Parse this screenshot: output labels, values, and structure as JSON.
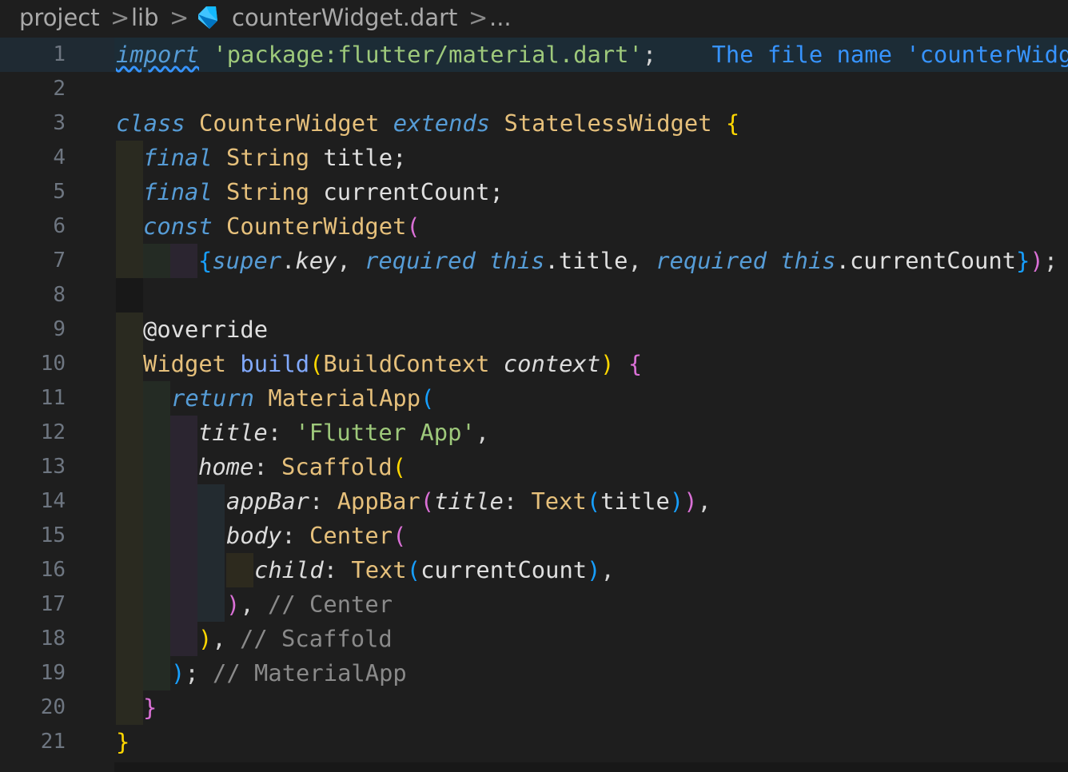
{
  "breadcrumb": {
    "items": [
      "project",
      "lib",
      "counterWidget.dart",
      "..."
    ],
    "separator": ">",
    "file_icon": "dart-icon"
  },
  "editor": {
    "lines": [
      {
        "n": "1"
      },
      {
        "n": "2"
      },
      {
        "n": "3"
      },
      {
        "n": "4"
      },
      {
        "n": "5"
      },
      {
        "n": "6"
      },
      {
        "n": "7"
      },
      {
        "n": "8"
      },
      {
        "n": "9"
      },
      {
        "n": "10"
      },
      {
        "n": "11"
      },
      {
        "n": "12"
      },
      {
        "n": "13"
      },
      {
        "n": "14"
      },
      {
        "n": "15"
      },
      {
        "n": "16"
      },
      {
        "n": "17"
      },
      {
        "n": "18"
      },
      {
        "n": "19"
      },
      {
        "n": "20"
      },
      {
        "n": "21"
      }
    ],
    "code": {
      "l1_import": "import",
      "l1_string": "'package:flutter/material.dart'",
      "l1_semi": ";",
      "l1_hint": "The file name 'counterWidg",
      "l3_class": "class",
      "l3_name": "CounterWidget",
      "l3_extends": "extends",
      "l3_super": "StatelessWidget",
      "l3_brace": "{",
      "l4_final": "final",
      "l4_type": "String",
      "l4_var": "title;",
      "l5_final": "final",
      "l5_type": "String",
      "l5_var": "currentCount;",
      "l6_const": "const",
      "l6_name": "CounterWidget",
      "l6_paren": "(",
      "l7_open": "{",
      "l7_super": "super",
      "l7_dot": ".",
      "l7_key": "key",
      "l7_comma1": ", ",
      "l7_required1": "required",
      "l7_this1": "this",
      "l7_title": ".title",
      "l7_comma2": ", ",
      "l7_required2": "required",
      "l7_this2": "this",
      "l7_count": ".currentCount",
      "l7_close": "}",
      "l7_paren": ")",
      "l7_semi": ";",
      "l9_override": "@override",
      "l10_widget": "Widget",
      "l10_build": "build",
      "l10_paren": "(",
      "l10_ctx_type": "BuildContext",
      "l10_ctx": "context",
      "l10_close": ")",
      "l10_brace": "{",
      "l11_return": "return",
      "l11_app": "MaterialApp",
      "l11_paren": "(",
      "l12_title": "title",
      "l12_colon": ": ",
      "l12_str": "'Flutter App'",
      "l12_comma": ",",
      "l13_home": "home",
      "l13_colon": ": ",
      "l13_scaffold": "Scaffold",
      "l13_paren": "(",
      "l14_appbar": "appBar",
      "l14_colon": ": ",
      "l14_AppBar": "AppBar",
      "l14_paren": "(",
      "l14_title": "title",
      "l14_colon2": ": ",
      "l14_text": "Text",
      "l14_paren2": "(",
      "l14_var": "title",
      "l14_close2": ")",
      "l14_close": ")",
      "l14_comma": ",",
      "l15_body": "body",
      "l15_colon": ": ",
      "l15_center": "Center",
      "l15_paren": "(",
      "l16_child": "child",
      "l16_colon": ": ",
      "l16_text": "Text",
      "l16_paren": "(",
      "l16_var": "currentCount",
      "l16_close": ")",
      "l16_comma": ",",
      "l17_close": ")",
      "l17_comma": ", ",
      "l17_comment": "// Center",
      "l18_close": ")",
      "l18_comma": ", ",
      "l18_comment": "// Scaffold",
      "l19_close": ")",
      "l19_semi": "; ",
      "l19_comment": "// MaterialApp",
      "l20_brace": "}",
      "l21_brace": "}"
    }
  },
  "colors": {
    "background": "#1e1e1e",
    "keyword": "#569cd6",
    "class": "#e6c07b",
    "string": "#9ec97b",
    "comment": "#8a8a8a",
    "bracket_yellow": "#ffd700",
    "bracket_pink": "#da70d6",
    "bracket_blue": "#179fff",
    "hint": "#3794ff"
  }
}
